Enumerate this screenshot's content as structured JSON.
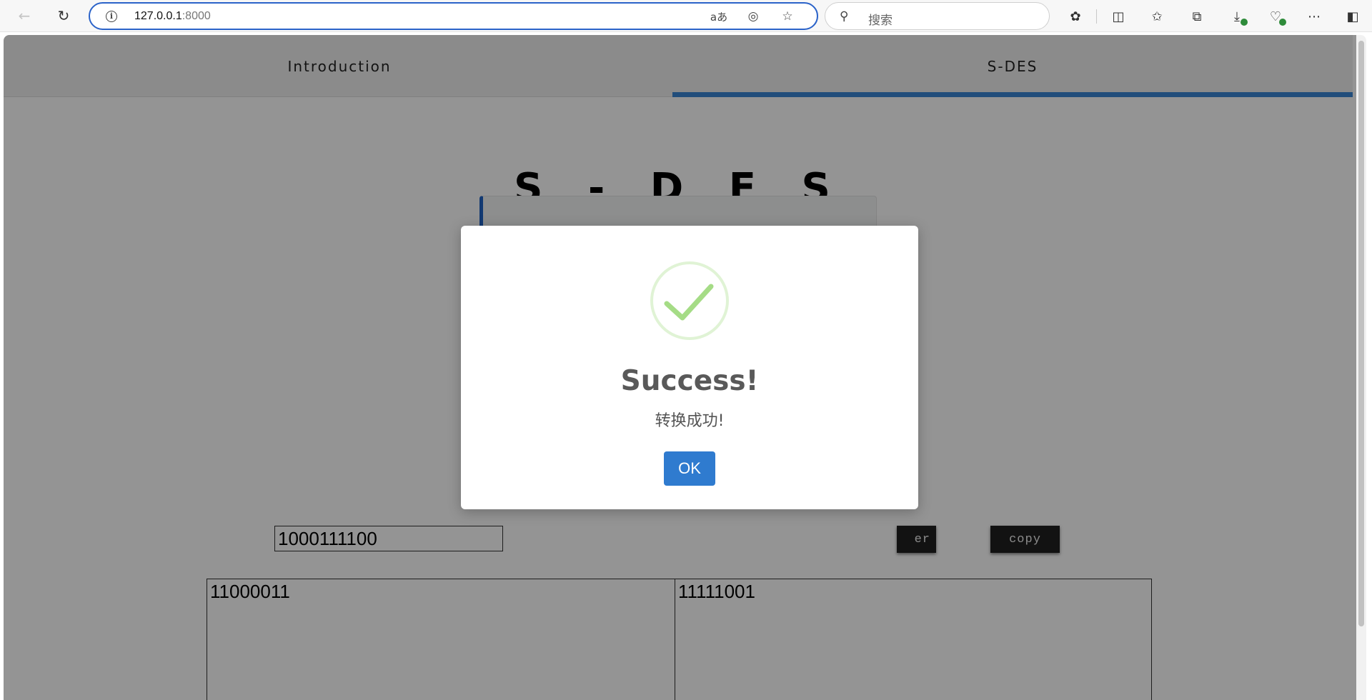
{
  "browser": {
    "url_host": "127.0.0.1",
    "url_port": ":8000",
    "search_placeholder": "搜索",
    "read_aloud_glyph": "aあ"
  },
  "tabs": [
    {
      "label": "Introduction",
      "active": false
    },
    {
      "label": "S-DES",
      "active": true
    }
  ],
  "page": {
    "title": "S - D E S",
    "input_value": "1000111100",
    "partial_button_label": "er",
    "copy_button_label": "copy",
    "output_left": "11000011",
    "output_right": "11111001"
  },
  "modal": {
    "title": "Success!",
    "message": "转换成功!",
    "ok_label": "OK",
    "icon": "checkmark-circle-icon",
    "icon_color": "#a5dc86"
  },
  "colors": {
    "accent": "#3a86d4",
    "panel_border": "#1f63c5",
    "ok_button": "#2f7bcf"
  }
}
